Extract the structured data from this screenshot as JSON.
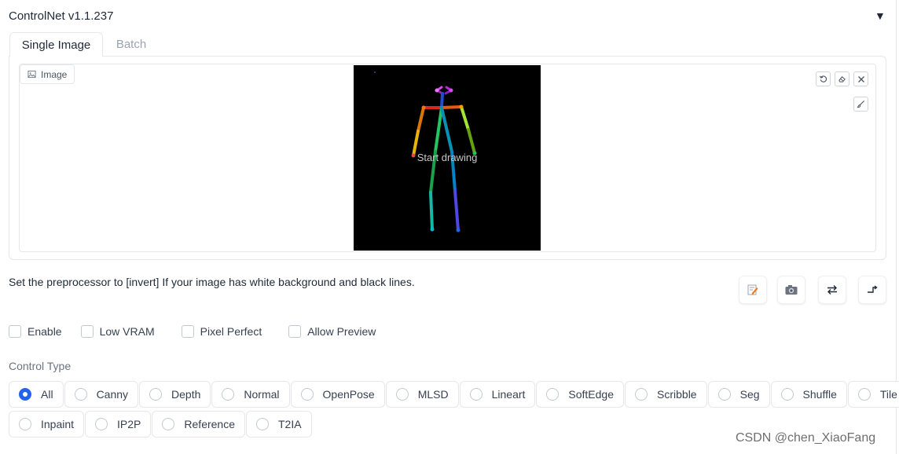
{
  "accordion": {
    "title": "ControlNet v1.1.237",
    "toggle": "▼"
  },
  "tabs": [
    {
      "label": "Single Image",
      "active": true
    },
    {
      "label": "Batch",
      "active": false
    }
  ],
  "image_block": {
    "label": "Image",
    "canvas_text": "Start drawing",
    "canvas_bg": "#000000"
  },
  "hint": "Set the preprocessor to [invert] If your image has white background and black lines.",
  "options": [
    {
      "label": "Enable",
      "checked": false
    },
    {
      "label": "Low VRAM",
      "checked": false
    },
    {
      "label": "Pixel Perfect",
      "checked": false
    },
    {
      "label": "Allow Preview",
      "checked": false
    }
  ],
  "control_type": {
    "label": "Control Type",
    "options": [
      "All",
      "Canny",
      "Depth",
      "Normal",
      "OpenPose",
      "MLSD",
      "Lineart",
      "SoftEdge",
      "Scribble",
      "Seg",
      "Shuffle",
      "Tile",
      "Inpaint",
      "IP2P",
      "Reference",
      "T2IA"
    ],
    "selected": "All"
  },
  "colors": {
    "accent": "#2563eb",
    "border": "#e5e7eb"
  },
  "watermark": "CSDN @chen_XiaoFang"
}
